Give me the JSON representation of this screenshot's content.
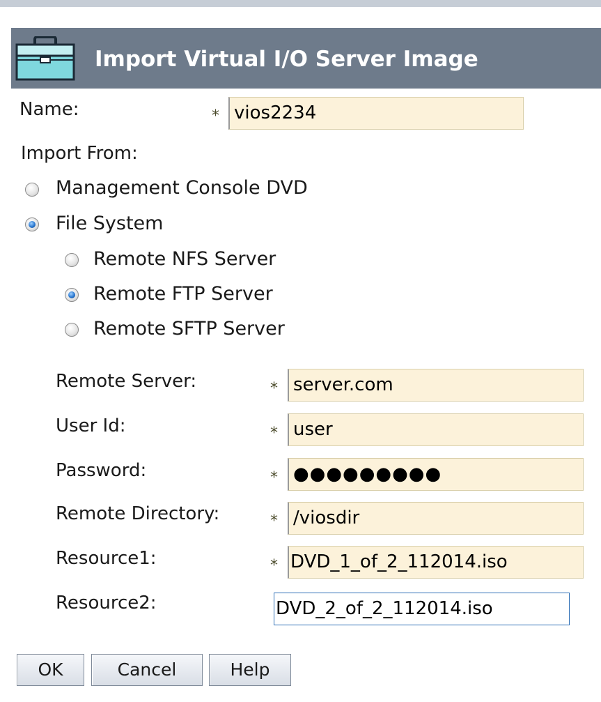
{
  "dialog": {
    "title": "Import Virtual I/O Server Image",
    "icon": "toolbox-icon"
  },
  "name": {
    "label": "Name:",
    "value": "vios2234",
    "required_mark": "*"
  },
  "import_from": {
    "label": "Import From:",
    "options": [
      {
        "label": "Management Console DVD",
        "checked": false
      },
      {
        "label": "File System",
        "checked": true
      }
    ],
    "file_system_options": [
      {
        "label": "Remote NFS Server",
        "checked": false
      },
      {
        "label": "Remote FTP Server",
        "checked": true
      },
      {
        "label": "Remote SFTP Server",
        "checked": false
      }
    ]
  },
  "fields": {
    "remote_server": {
      "label": "Remote Server:",
      "value": "server.com",
      "required_mark": "*"
    },
    "user_id": {
      "label": "User Id:",
      "value": "user",
      "required_mark": "*"
    },
    "password": {
      "label": "Password:",
      "value": "●●●●●●●●●",
      "required_mark": "*"
    },
    "remote_directory": {
      "label": "Remote Directory:",
      "value": "/viosdir",
      "required_mark": "*"
    },
    "resource1": {
      "label": "Resource1:",
      "value": "DVD_1_of_2_112014.iso",
      "required_mark": "*"
    },
    "resource2": {
      "label": "Resource2:",
      "value": "DVD_2_of_2_112014.iso"
    }
  },
  "buttons": {
    "ok": "OK",
    "cancel": "Cancel",
    "help": "Help"
  },
  "colors": {
    "title_bar": "#6e7b8b",
    "field_bg": "#fcf2da",
    "radio_selected": "#2a78d0",
    "focus_border": "#2f6fb6"
  }
}
